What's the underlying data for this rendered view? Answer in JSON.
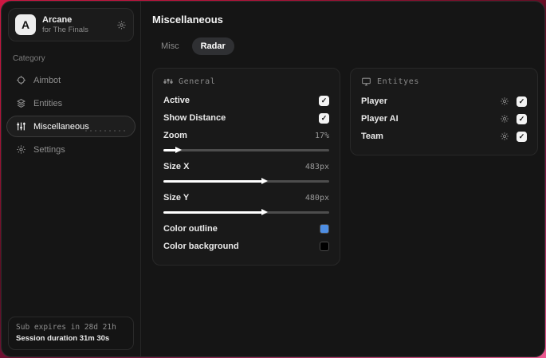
{
  "brand": {
    "logo_letter": "A",
    "title": "Arcane",
    "subtitle": "for The Finals"
  },
  "sidebar": {
    "category_label": "Category",
    "items": [
      {
        "label": "Aimbot",
        "icon": "crosshair-icon",
        "active": false
      },
      {
        "label": "Entities",
        "icon": "entities-icon",
        "active": false
      },
      {
        "label": "Miscellaneous",
        "icon": "sliders-icon",
        "active": true
      },
      {
        "label": "Settings",
        "icon": "gear-icon",
        "active": false
      }
    ],
    "footer": {
      "line1": "Sub expires in 28d 21h",
      "line2": "Session duration 31m 30s"
    }
  },
  "main": {
    "title": "Miscellaneous",
    "tabs": [
      {
        "label": "Misc",
        "active": false
      },
      {
        "label": "Radar",
        "active": true
      }
    ]
  },
  "general": {
    "title": "General",
    "rows": {
      "active": {
        "label": "Active",
        "checked": true
      },
      "showDistance": {
        "label": "Show Distance",
        "checked": true
      },
      "zoom": {
        "label": "Zoom",
        "value": "17%",
        "percent": 8
      },
      "sizeX": {
        "label": "Size X",
        "value": "483px",
        "percent": 60
      },
      "sizeY": {
        "label": "Size Y",
        "value": "480px",
        "percent": 60
      },
      "colorOutline": {
        "label": "Color outline",
        "color": "#4e8ee3"
      },
      "colorBackground": {
        "label": "Color background",
        "color": "#000000"
      }
    }
  },
  "entities": {
    "title": "Entityes",
    "rows": [
      {
        "label": "Player",
        "checked": true
      },
      {
        "label": "Player AI",
        "checked": true
      },
      {
        "label": "Team",
        "checked": true
      }
    ]
  },
  "icons": {
    "check_glyph": "✓"
  },
  "colors": {
    "accent_blue": "#4e8ee3",
    "background_behind_window": "#c21540",
    "window_bg": "#151515",
    "panel_bg": "#191919"
  }
}
